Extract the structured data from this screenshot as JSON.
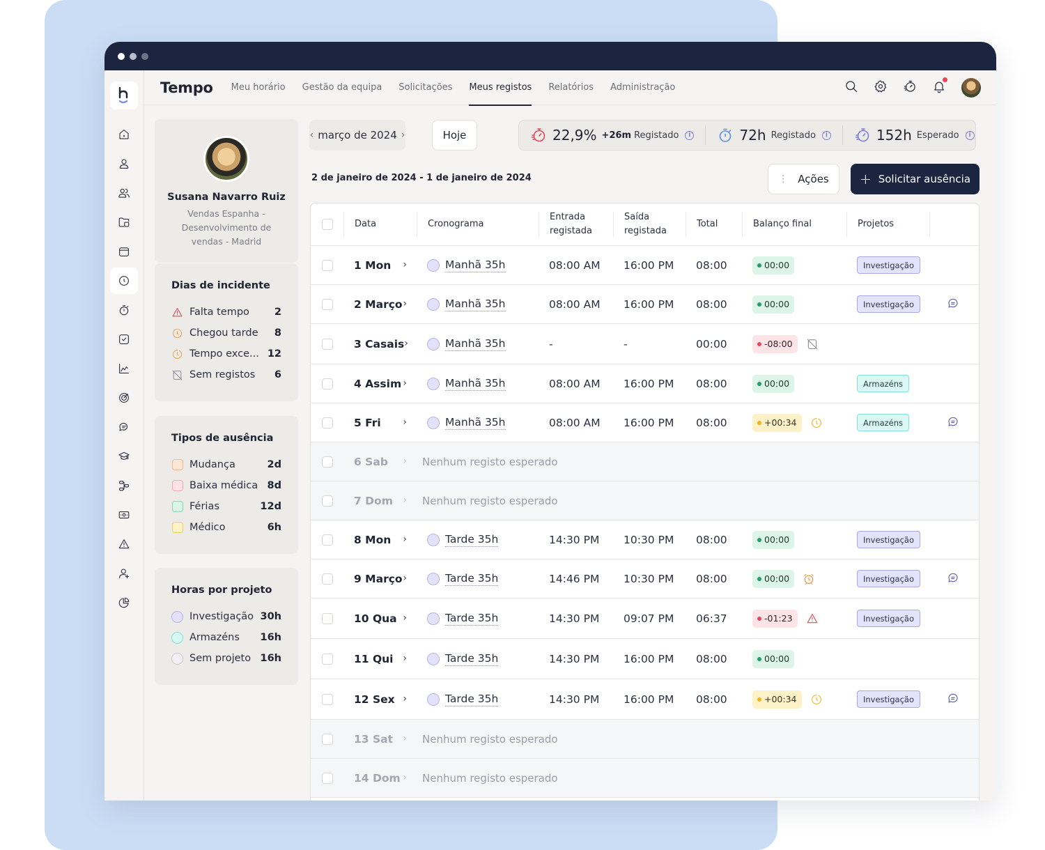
{
  "app": {
    "title": "Tempo",
    "nav_tabs": [
      {
        "label": "Meu horário",
        "active": false
      },
      {
        "label": "Gestão da equipa",
        "active": false
      },
      {
        "label": "Solicitações",
        "active": false
      },
      {
        "label": "Meus registos",
        "active": true
      },
      {
        "label": "Relatórios",
        "active": false
      },
      {
        "label": "Administração",
        "active": false
      }
    ],
    "top_icons": [
      "search-icon",
      "gear-icon",
      "speed-timer-icon",
      "bell-icon",
      "user-avatar"
    ],
    "notification_dot": true
  },
  "rail": {
    "logo": "b",
    "items": [
      "home-icon",
      "user-icon",
      "users-icon",
      "folder-icon",
      "calendar-icon",
      "clock-icon",
      "stopwatch-icon",
      "checkbox-icon",
      "chart-line-icon",
      "target-icon",
      "chat-icon",
      "graduation-cap-icon",
      "workflow-icon",
      "money-icon",
      "alert-triangle-icon",
      "user-plus-icon",
      "pie-chart-icon"
    ],
    "active_index": 5
  },
  "profile": {
    "name": "Susana Navarro Ruiz",
    "department": "Vendas Espanha - Desenvolvimento de vendas - Madrid"
  },
  "incidents": {
    "title": "Dias de incidente",
    "items": [
      {
        "label": "Falta tempo",
        "value": "2",
        "icon": "alert-triangle-icon",
        "color": "#e5485d"
      },
      {
        "label": "Chegou tarde",
        "value": "8",
        "icon": "clock-late-icon",
        "color": "#f0a050"
      },
      {
        "label": "Tempo exce...",
        "value": "12",
        "icon": "clock-extra-icon",
        "color": "#f0a050"
      },
      {
        "label": "Sem registos",
        "value": "6",
        "icon": "no-records-icon",
        "color": "#8a8e98"
      }
    ]
  },
  "absence_types": {
    "title": "Tipos de ausência",
    "items": [
      {
        "label": "Mudança",
        "value": "2d",
        "bg": "#fde7d4",
        "border": "#f6b98a"
      },
      {
        "label": "Baixa médica",
        "value": "8d",
        "bg": "#fde2e6",
        "border": "#f3a9b4"
      },
      {
        "label": "Férias",
        "value": "12d",
        "bg": "#d8f5e6",
        "border": "#86d9ae"
      },
      {
        "label": "Médico",
        "value": "6h",
        "bg": "#fdf1c6",
        "border": "#f4cf6a"
      }
    ]
  },
  "project_hours": {
    "title": "Horas por projeto",
    "items": [
      {
        "label": "Investigação",
        "value": "30h",
        "bg": "#e4e2fb",
        "border": "#b7b4ee"
      },
      {
        "label": "Armazéns",
        "value": "16h",
        "bg": "#d6f8f5",
        "border": "#86e0da"
      },
      {
        "label": "Sem projeto",
        "value": "16h",
        "bg": "#f1f1f3",
        "border": "#c9cbd1"
      }
    ]
  },
  "toolbar": {
    "month": "março de 2024",
    "today_label": "Hoje",
    "stats": [
      {
        "value": "22,9%",
        "delta": "+26m",
        "label": "Registado",
        "color": "#e5485d"
      },
      {
        "value": "72h",
        "delta": "",
        "label": "Registado",
        "color": "#5f8de0"
      },
      {
        "value": "152h",
        "delta": "",
        "label": "Esperado",
        "color": "#7b7fd8"
      }
    ],
    "range": "2 de janeiro de 2024 - 1 de janeiro de 2024",
    "actions_label": "Ações",
    "request_label": "Solicitar ausência"
  },
  "table": {
    "headers": [
      "Data",
      "Cronograma",
      "Entrada registada",
      "Saída registada",
      "Total",
      "Balanço final",
      "Projetos"
    ],
    "rows": [
      {
        "day": "1 Mon",
        "schedule": "Manhã 35h",
        "in": "08:00 AM",
        "out": "16:00 PM",
        "total": "08:00",
        "balance": "00:00",
        "status": "ok",
        "flag": "",
        "project": "Investigação",
        "ptype": "inv",
        "comment": false
      },
      {
        "day": "2 Março",
        "schedule": "Manhã 35h",
        "in": "08:00 AM",
        "out": "16:00 PM",
        "total": "08:00",
        "balance": "00:00",
        "status": "ok",
        "flag": "",
        "project": "Investigação",
        "ptype": "inv",
        "comment": true
      },
      {
        "day": "3 Casais",
        "schedule": "Manhã 35h",
        "in": "-",
        "out": "-",
        "total": "00:00",
        "balance": "-08:00",
        "status": "neg",
        "flag": "no-records-icon",
        "project": "",
        "ptype": "",
        "comment": false
      },
      {
        "day": "4 Assim",
        "schedule": "Manhã 35h",
        "in": "08:00 AM",
        "out": "16:00 PM",
        "total": "08:00",
        "balance": "00:00",
        "status": "ok",
        "flag": "",
        "project": "Armazéns",
        "ptype": "arm",
        "comment": false
      },
      {
        "day": "5 Fri",
        "schedule": "Manhã 35h",
        "in": "08:00 AM",
        "out": "16:00 PM",
        "total": "08:00",
        "balance": "+00:34",
        "status": "pos",
        "flag": "clock-extra-icon",
        "project": "Armazéns",
        "ptype": "arm",
        "comment": true
      },
      {
        "day": "6 Sab",
        "off": true,
        "note": "Nenhum registo esperado"
      },
      {
        "day": "7 Dom",
        "off": true,
        "note": "Nenhum registo esperado"
      },
      {
        "day": "8 Mon",
        "schedule": "Tarde 35h",
        "in": "14:30 PM",
        "out": "10:30 PM",
        "total": "08:00",
        "balance": "00:00",
        "status": "ok",
        "flag": "",
        "project": "Investigação",
        "ptype": "inv",
        "comment": false
      },
      {
        "day": "9 Março",
        "schedule": "Tarde 35h",
        "in": "14:46 PM",
        "out": "10:30 PM",
        "total": "08:00",
        "balance": "00:00",
        "status": "ok",
        "flag": "alarm-clock-icon",
        "project": "Investigação",
        "ptype": "inv",
        "comment": true
      },
      {
        "day": "10 Qua",
        "schedule": "Tarde 35h",
        "in": "14:30 PM",
        "out": "09:07 PM",
        "total": "06:37",
        "balance": "-01:23",
        "status": "neg",
        "flag": "alert-triangle-icon",
        "project": "Investigação",
        "ptype": "inv",
        "comment": false
      },
      {
        "day": "11 Qui",
        "schedule": "Tarde 35h",
        "in": "14:30 PM",
        "out": "16:00 PM",
        "total": "08:00",
        "balance": "00:00",
        "status": "ok",
        "flag": "",
        "project": "",
        "ptype": "",
        "comment": false
      },
      {
        "day": "12 Sex",
        "schedule": "Tarde 35h",
        "in": "14:30 PM",
        "out": "16:00 PM",
        "total": "08:00",
        "balance": "+00:34",
        "status": "pos",
        "flag": "clock-extra-icon",
        "project": "Investigação",
        "ptype": "inv",
        "comment": true
      },
      {
        "day": "13 Sat",
        "off": true,
        "note": "Nenhum registo esperado"
      },
      {
        "day": "14 Dom",
        "off": true,
        "note": "Nenhum registo esperado"
      }
    ]
  }
}
